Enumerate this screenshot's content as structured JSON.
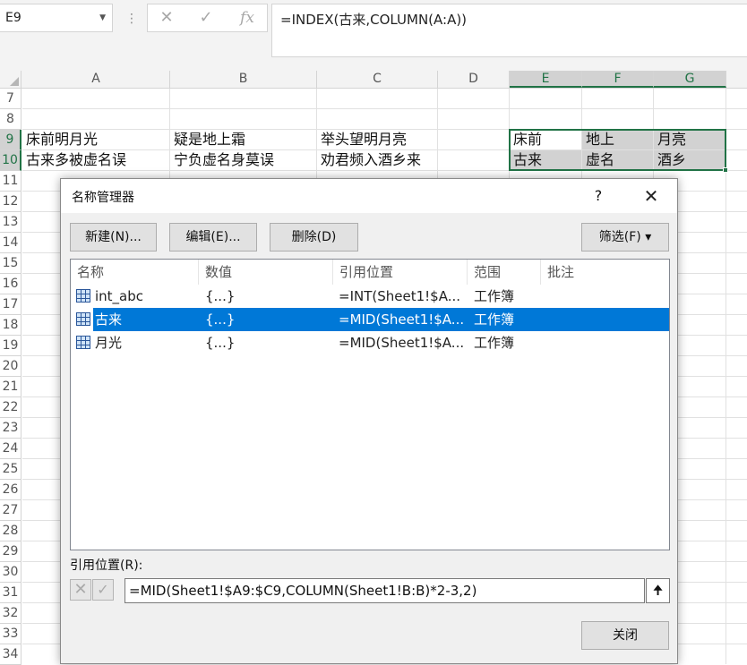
{
  "formula_bar": {
    "name_box": "E9",
    "formula": "=INDEX(古来,COLUMN(A:A))",
    "cancel_icon": "x-icon",
    "enter_icon": "check-icon",
    "function_icon": "fx-icon",
    "fx_label": "fx"
  },
  "grid": {
    "columns": [
      "A",
      "B",
      "C",
      "D",
      "E",
      "F",
      "G"
    ],
    "rows": [
      "7",
      "8",
      "9",
      "10",
      "11",
      "12",
      "13",
      "14",
      "15",
      "16",
      "17",
      "18",
      "19",
      "20",
      "21",
      "22",
      "23",
      "24",
      "25",
      "26",
      "27",
      "28",
      "29",
      "30",
      "31",
      "32",
      "33",
      "34"
    ],
    "cells": {
      "A9": "床前明月光",
      "B9": "疑是地上霜",
      "C9": "举头望明月亮",
      "E9": "床前",
      "F9": "地上",
      "G9": "月亮",
      "A10": "古来多被虚名误",
      "B10": "宁负虚名身莫误",
      "C10": "劝君频入酒乡来",
      "E10": "古来",
      "F10": "虚名",
      "G10": "酒乡"
    },
    "accent_color": "#217346"
  },
  "dialog": {
    "title": "名称管理器",
    "help": "?",
    "close_x": "✕",
    "buttons": {
      "new": "新建(N)...",
      "edit": "编辑(E)...",
      "delete": "删除(D)",
      "filter": "筛选(F) ▾"
    },
    "list": {
      "headers": [
        "名称",
        "数值",
        "引用位置",
        "范围",
        "批注"
      ],
      "rows": [
        {
          "name": "int_abc",
          "value": "{...}",
          "refers": "=INT(Sheet1!$A...",
          "scope": "工作簿",
          "comment": ""
        },
        {
          "name": "古来",
          "value": "{...}",
          "refers": "=MID(Sheet1!$A...",
          "scope": "工作簿",
          "comment": ""
        },
        {
          "name": "月光",
          "value": "{...}",
          "refers": "=MID(Sheet1!$A...",
          "scope": "工作簿",
          "comment": ""
        }
      ],
      "selected_index": 1,
      "selection_color": "#0078d7"
    },
    "refers_to_label": "引用位置(R):",
    "refers_to_value": "=MID(Sheet1!$A9:$C9,COLUMN(Sheet1!B:B)*2-3,2)",
    "close_button": "关闭"
  }
}
